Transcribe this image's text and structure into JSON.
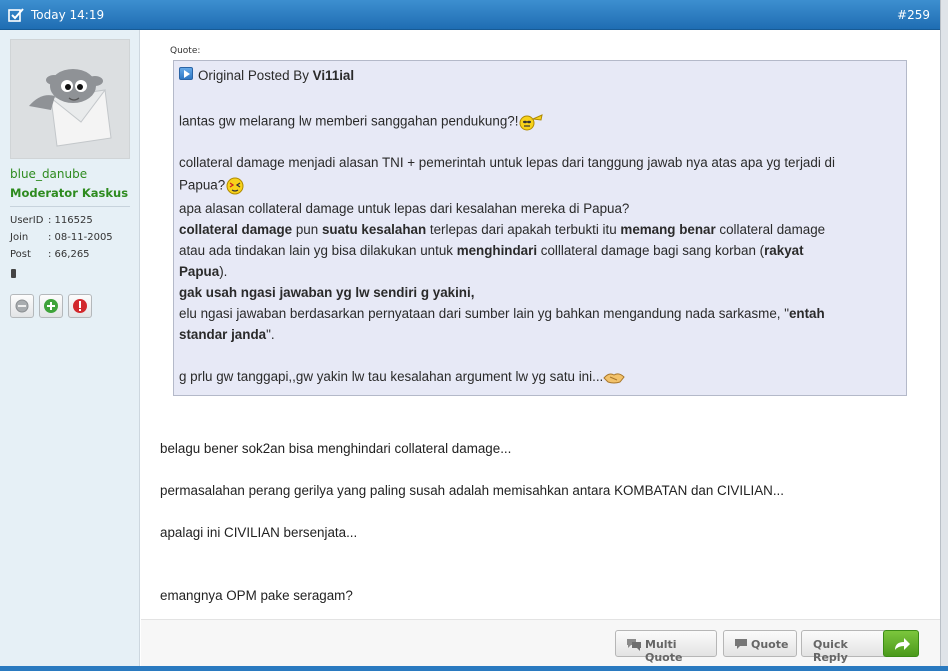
{
  "header": {
    "date": "Today 14:19",
    "post_number": "#259"
  },
  "user": {
    "username": "blue_danube",
    "title": "Moderator Kaskus",
    "stats": [
      {
        "key": "UserID",
        "value": ": 116525"
      },
      {
        "key": "Join",
        "value": ": 08-11-2005"
      },
      {
        "key": "Post",
        "value": ": 66,265"
      }
    ],
    "icons": [
      "status-offline-icon",
      "add-reputation-icon",
      "report-icon"
    ]
  },
  "quote": {
    "label": "Quote:",
    "posted_by_prefix": "Original Posted By",
    "author": "Vi11ial",
    "lines": {
      "l1": "lantas gw melarang lw memberi sanggahan pendukung?!",
      "l2": "collateral damage menjadi alasan TNI + pemerintah untuk lepas dari tanggung jawab nya atas apa yg terjadi di",
      "l3": "Papua?",
      "l4": "apa alasan collateral damage untuk lepas dari kesalahan mereka di Papua?",
      "l5a": "collateral damage",
      "l5b": " pun ",
      "l5c": "suatu kesalahan",
      "l5d": " terlepas dari apakah terbukti itu ",
      "l5e": "memang benar",
      "l5f": " collateral damage",
      "l6a": "atau ada tindakan lain yg bisa dilakukan untuk ",
      "l6b": "menghindari",
      "l6c": " colllateral damage bagi sang korban (",
      "l6d": "rakyat",
      "l7a": "Papua",
      "l7b": ").",
      "l8": "gak usah ngasi jawaban yg lw sendiri g yakini,",
      "l9a": "elu ngasi jawaban berdasarkan pernyataan dari sumber lain yg bahkan mengandung nada sarkasme, \"",
      "l9b": "entah",
      "l10a": "standar janda",
      "l10b": "\".",
      "l11": "g prlu gw tanggapi,,gw yakin lw tau kesalahan argument lw yg satu ini..."
    }
  },
  "message": {
    "p1": "belagu bener sok2an bisa menghindari collateral damage...",
    "p2": "permasalahan perang gerilya yang paling susah adalah memisahkan antara KOMBATAN dan CIVILIAN...",
    "p3": "apalagi ini CIVILIAN bersenjata...",
    "p4": "emangnya OPM pake seragam?"
  },
  "actions": {
    "multi_quote": "Multi Quote",
    "quote": "Quote",
    "quick_reply": "Quick Reply"
  },
  "colors": {
    "header_blue": "#1f6db3",
    "username_green": "#2e8b1f",
    "quote_bg": "#e7e9f6",
    "reply_green": "#4b9a1c"
  }
}
